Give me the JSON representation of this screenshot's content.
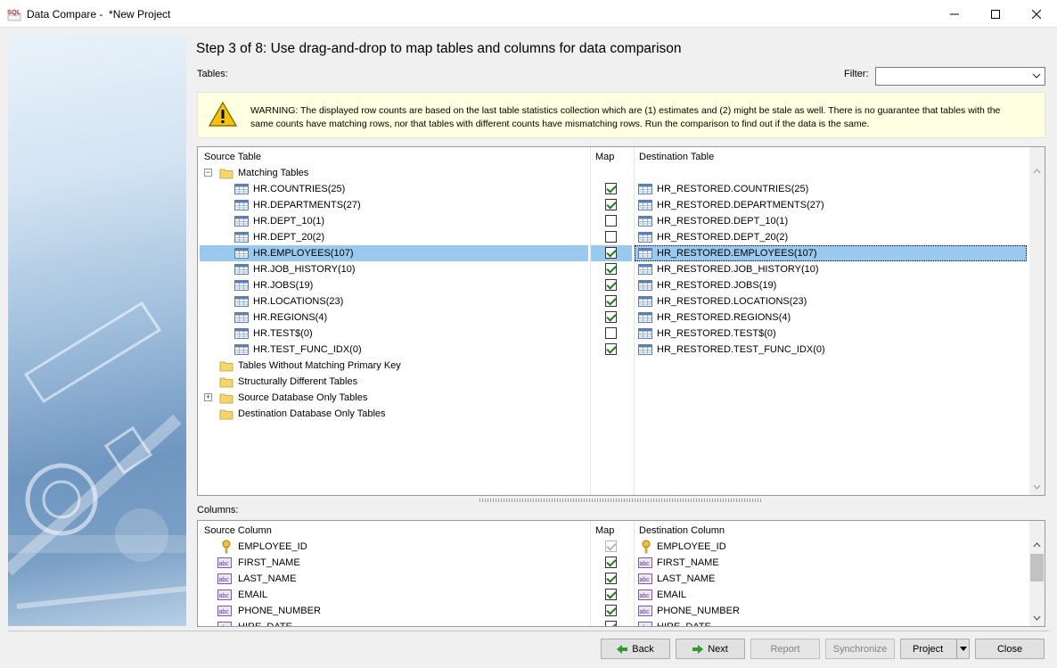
{
  "window": {
    "title": "Data Compare -  *New Project",
    "app_badge": "SQL"
  },
  "wizard": {
    "heading": "Step 3 of 8:  Use drag-and-drop to map tables and columns for data comparison",
    "tables_label": "Tables:",
    "filter_label": "Filter:",
    "filter_value": "",
    "columns_label": "Columns:"
  },
  "warning": {
    "text": "WARNING: The displayed row counts are based on the last table statistics collection which are (1) estimates and (2) might be stale as well. There is no guarantee that tables with the same counts have matching rows, nor that tables with different counts have mismatching rows. Run the comparison to find out if the data is the same."
  },
  "tables_grid": {
    "headers": {
      "source": "Source Table",
      "map": "Map",
      "destination": "Destination Table"
    },
    "matching_group": "Matching Tables",
    "rows": [
      {
        "source": "HR.COUNTRIES(25)",
        "mapped": true,
        "destination": "HR_RESTORED.COUNTRIES(25)"
      },
      {
        "source": "HR.DEPARTMENTS(27)",
        "mapped": true,
        "destination": "HR_RESTORED.DEPARTMENTS(27)"
      },
      {
        "source": "HR.DEPT_10(1)",
        "mapped": false,
        "destination": "HR_RESTORED.DEPT_10(1)"
      },
      {
        "source": "HR.DEPT_20(2)",
        "mapped": false,
        "destination": "HR_RESTORED.DEPT_20(2)"
      },
      {
        "source": "HR.EMPLOYEES(107)",
        "mapped": true,
        "destination": "HR_RESTORED.EMPLOYEES(107)",
        "selected": true
      },
      {
        "source": "HR.JOB_HISTORY(10)",
        "mapped": true,
        "destination": "HR_RESTORED.JOB_HISTORY(10)"
      },
      {
        "source": "HR.JOBS(19)",
        "mapped": true,
        "destination": "HR_RESTORED.JOBS(19)"
      },
      {
        "source": "HR.LOCATIONS(23)",
        "mapped": true,
        "destination": "HR_RESTORED.LOCATIONS(23)"
      },
      {
        "source": "HR.REGIONS(4)",
        "mapped": true,
        "destination": "HR_RESTORED.REGIONS(4)"
      },
      {
        "source": "HR.TEST$(0)",
        "mapped": false,
        "destination": "HR_RESTORED.TEST$(0)"
      },
      {
        "source": "HR.TEST_FUNC_IDX(0)",
        "mapped": true,
        "destination": "HR_RESTORED.TEST_FUNC_IDX(0)"
      }
    ],
    "other_groups": [
      {
        "label": "Tables Without Matching Primary Key",
        "expander": ""
      },
      {
        "label": "Structurally Different Tables",
        "expander": ""
      },
      {
        "label": "Source Database Only Tables",
        "expander": "+"
      },
      {
        "label": "Destination Database Only Tables",
        "expander": ""
      }
    ]
  },
  "columns_grid": {
    "headers": {
      "source": "Source Column",
      "map": "Map",
      "destination": "Destination Column"
    },
    "rows": [
      {
        "source": "EMPLOYEE_ID",
        "type": "key",
        "mapped": true,
        "disabled": true,
        "destination": "EMPLOYEE_ID"
      },
      {
        "source": "FIRST_NAME",
        "type": "abc",
        "mapped": true,
        "destination": "FIRST_NAME"
      },
      {
        "source": "LAST_NAME",
        "type": "abc",
        "mapped": true,
        "destination": "LAST_NAME"
      },
      {
        "source": "EMAIL",
        "type": "abc",
        "mapped": true,
        "destination": "EMAIL"
      },
      {
        "source": "PHONE_NUMBER",
        "type": "abc",
        "mapped": true,
        "destination": "PHONE_NUMBER"
      },
      {
        "source": "HIRE_DATE",
        "type": "abc",
        "mapped": true,
        "destination": "HIRE_DATE"
      }
    ]
  },
  "buttons": {
    "back": "Back",
    "next": "Next",
    "report": "Report",
    "synchronize": "Synchronize",
    "project": "Project",
    "close": "Close"
  },
  "colors": {
    "selection": "#99c9ef",
    "warning_bg": "#ffffe1",
    "check_green": "#1a7f1a",
    "next_arrow": "#2d9b2d"
  }
}
